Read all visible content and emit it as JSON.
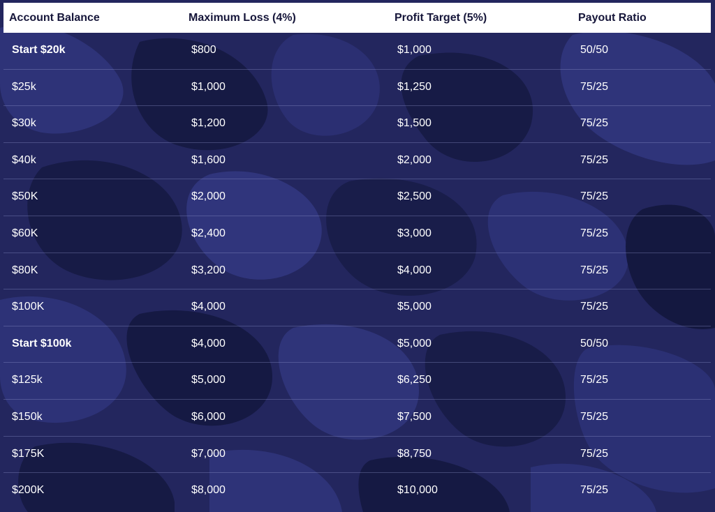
{
  "table": {
    "headers": [
      "Account Balance",
      "Maximum Loss (4%)",
      "Profit Target (5%)",
      "Payout Ratio"
    ],
    "rows": [
      {
        "balance": "Start $20k",
        "max_loss": "$800",
        "profit_target": "$1,000",
        "payout": "50/50",
        "bold": true
      },
      {
        "balance": "$25k",
        "max_loss": "$1,000",
        "profit_target": "$1,250",
        "payout": "75/25",
        "bold": false
      },
      {
        "balance": "$30k",
        "max_loss": "$1,200",
        "profit_target": "$1,500",
        "payout": "75/25",
        "bold": false
      },
      {
        "balance": "$40k",
        "max_loss": "$1,600",
        "profit_target": "$2,000",
        "payout": "75/25",
        "bold": false
      },
      {
        "balance": "$50K",
        "max_loss": "$2,000",
        "profit_target": "$2,500",
        "payout": "75/25",
        "bold": false
      },
      {
        "balance": "$60K",
        "max_loss": "$2,400",
        "profit_target": "$3,000",
        "payout": "75/25",
        "bold": false
      },
      {
        "balance": "$80K",
        "max_loss": "$3,200",
        "profit_target": "$4,000",
        "payout": "75/25",
        "bold": false
      },
      {
        "balance": "$100K",
        "max_loss": "$4,000",
        "profit_target": "$5,000",
        "payout": "75/25",
        "bold": false
      },
      {
        "balance": "Start $100k",
        "max_loss": "$4,000",
        "profit_target": "$5,000",
        "payout": "50/50",
        "bold": true
      },
      {
        "balance": "$125k",
        "max_loss": "$5,000",
        "profit_target": "$6,250",
        "payout": "75/25",
        "bold": false
      },
      {
        "balance": "$150k",
        "max_loss": "$6,000",
        "profit_target": "$7,500",
        "payout": "75/25",
        "bold": false
      },
      {
        "balance": "$175K",
        "max_loss": "$7,000",
        "profit_target": "$8,750",
        "payout": "75/25",
        "bold": false
      },
      {
        "balance": "$200K",
        "max_loss": "$8,000",
        "profit_target": "$10,000",
        "payout": "75/25",
        "bold": false
      }
    ]
  },
  "colors": {
    "background": "#1f2154",
    "header_background": "#ffffff",
    "header_text": "#16163a",
    "cell_text": "#ffffff"
  }
}
